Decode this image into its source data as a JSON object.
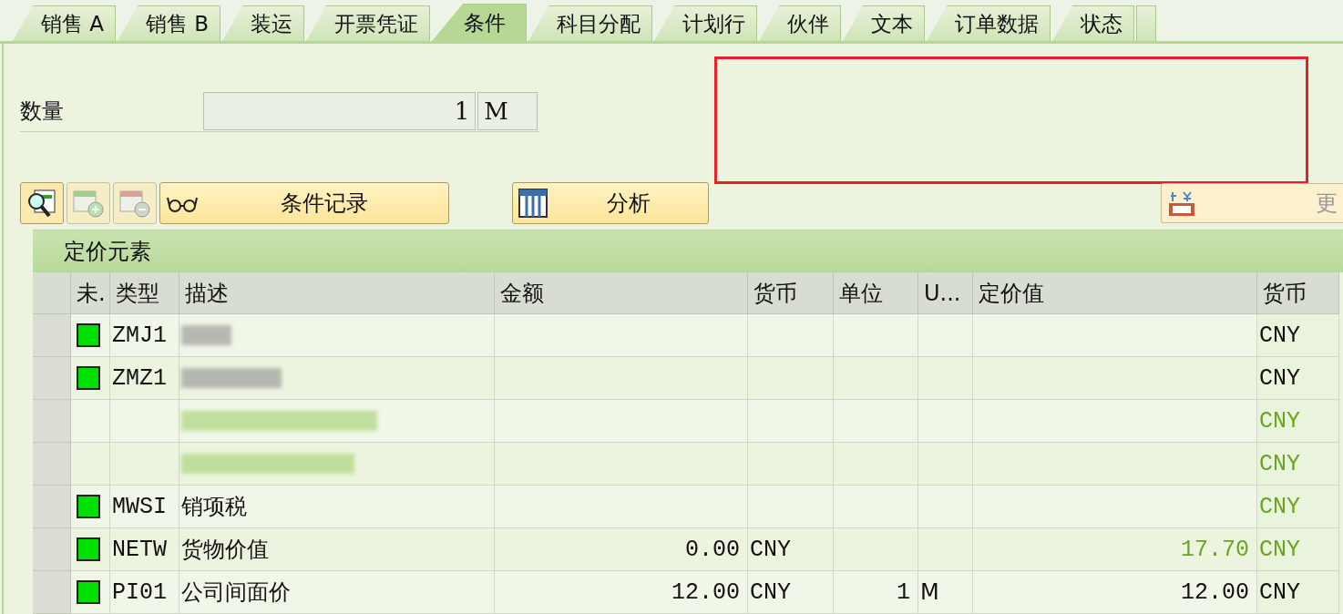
{
  "tabs": [
    {
      "label": "销售 A",
      "selected": false
    },
    {
      "label": "销售 B",
      "selected": false
    },
    {
      "label": "装运",
      "selected": false
    },
    {
      "label": "开票凭证",
      "selected": false
    },
    {
      "label": "条件",
      "selected": true
    },
    {
      "label": "科目分配",
      "selected": false
    },
    {
      "label": "计划行",
      "selected": false
    },
    {
      "label": "伙伴",
      "selected": false
    },
    {
      "label": "文本",
      "selected": false
    },
    {
      "label": "订单数据",
      "selected": false
    },
    {
      "label": "状态",
      "selected": false
    }
  ],
  "quantity": {
    "label": "数量",
    "value": "1",
    "unit": "M"
  },
  "highlight_box": {
    "color": "#e8202a"
  },
  "toolbar": {
    "buttons": [
      {
        "kind": "icon",
        "disabled": false
      },
      {
        "kind": "icon",
        "disabled": true
      },
      {
        "kind": "icon",
        "disabled": true
      },
      {
        "kind": "labeled",
        "label": "条件记录"
      },
      {
        "kind": "labeled",
        "label": "分析"
      }
    ],
    "update_button": {
      "label": "更",
      "disabled": true
    }
  },
  "section_title": "定价元素",
  "table": {
    "columns": [
      "未.",
      "类型",
      "描述",
      "金额",
      "货币",
      "单位",
      "U...",
      "定价值",
      "货币"
    ],
    "rows": [
      {
        "status": true,
        "type": "ZMJ1",
        "description": {
          "kind": "redacted"
        },
        "amount": "",
        "currency": "",
        "per": "",
        "unit": "",
        "value": "",
        "value_green": false,
        "value_currency": "CNY",
        "currency_green": false
      },
      {
        "status": true,
        "type": "ZMZ1",
        "description": {
          "kind": "redacted"
        },
        "amount": "",
        "currency": "",
        "per": "",
        "unit": "",
        "value": "",
        "value_green": false,
        "value_currency": "CNY",
        "currency_green": false
      },
      {
        "status": false,
        "type": "",
        "description": {
          "kind": "redacted"
        },
        "amount": "",
        "currency": "",
        "per": "",
        "unit": "",
        "value": "",
        "value_green": false,
        "value_currency": "CNY",
        "currency_green": true
      },
      {
        "status": false,
        "type": "",
        "description": {
          "kind": "redacted"
        },
        "amount": "",
        "currency": "",
        "per": "",
        "unit": "",
        "value": "",
        "value_green": false,
        "value_currency": "CNY",
        "currency_green": true
      },
      {
        "status": true,
        "type": "MWSI",
        "description": {
          "kind": "text",
          "text": "销项税"
        },
        "amount": "",
        "currency": "",
        "per": "",
        "unit": "",
        "value": "",
        "value_green": false,
        "value_currency": "CNY",
        "currency_green": true
      },
      {
        "status": true,
        "type": "NETW",
        "description": {
          "kind": "text",
          "text": "货物价值"
        },
        "amount": "0.00",
        "currency": "CNY",
        "per": "",
        "unit": "",
        "value": "17.70",
        "value_green": true,
        "value_currency": "CNY",
        "currency_green": true
      },
      {
        "status": true,
        "type": "PI01",
        "description": {
          "kind": "text",
          "text": "公司间面价"
        },
        "amount": "12.00",
        "currency": "CNY",
        "per": "1",
        "unit": "M",
        "value": "12.00",
        "value_green": false,
        "value_currency": "CNY",
        "currency_green": false
      }
    ]
  }
}
